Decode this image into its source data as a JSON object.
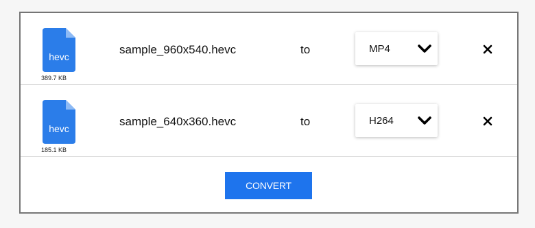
{
  "files": [
    {
      "extension": "hevc",
      "size": "389.7 KB",
      "name": "sample_960x540.hevc",
      "to_label": "to",
      "format": "MP4",
      "chevron_icon": "chevron-down-icon",
      "remove_icon": "close-icon"
    },
    {
      "extension": "hevc",
      "size": "185.1 KB",
      "name": "sample_640x360.hevc",
      "to_label": "to",
      "format": "H264",
      "chevron_icon": "chevron-down-icon",
      "remove_icon": "close-icon"
    }
  ],
  "convert_button": {
    "label": "CONVERT"
  },
  "colors": {
    "accent": "#1e74ed",
    "file_icon": "#2b7de9",
    "file_icon_fold": "#8dbaf5",
    "panel_border": "#757575"
  }
}
